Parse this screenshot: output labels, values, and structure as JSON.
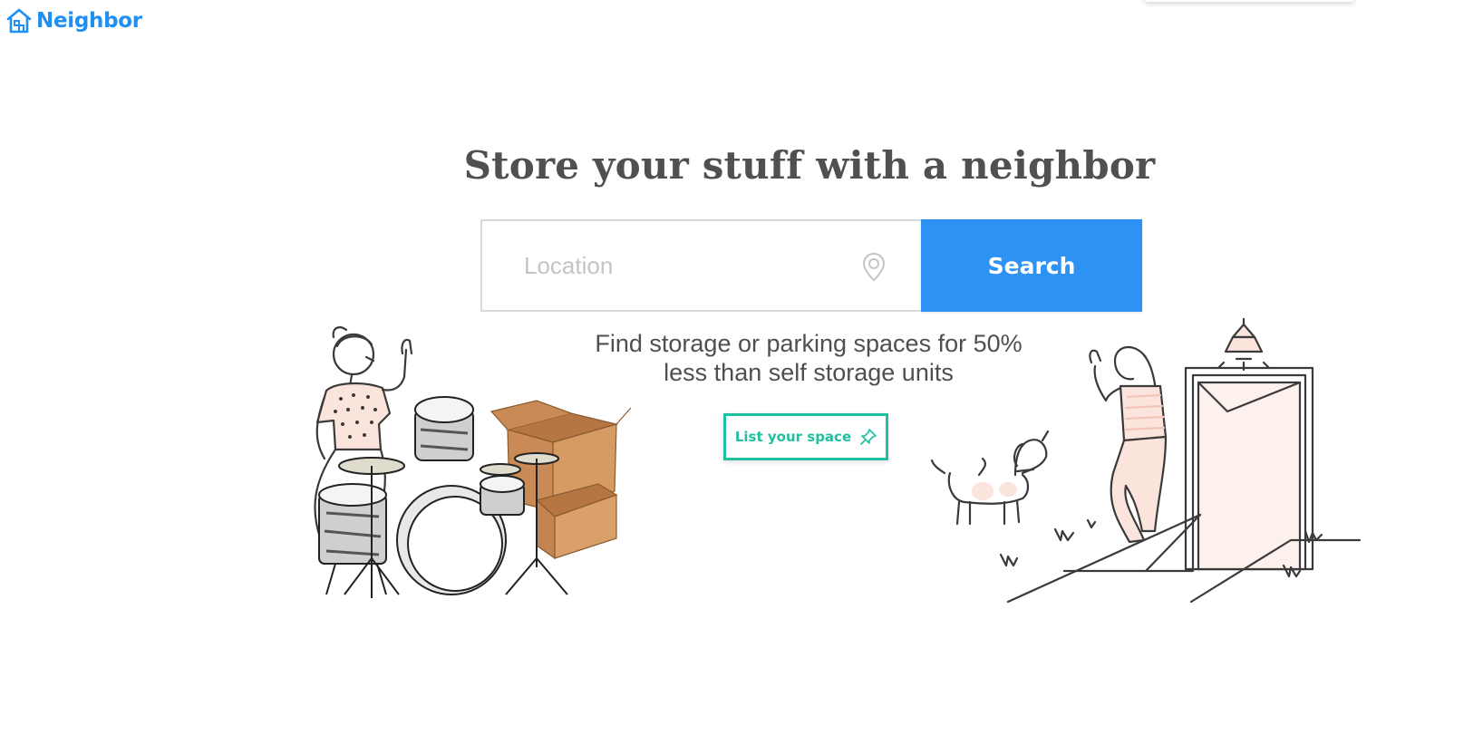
{
  "header": {
    "brand": "Neighbor"
  },
  "hero": {
    "headline": "Store your stuff with a neighbor",
    "location_placeholder": "Location",
    "search_label": "Search",
    "subtitle_line1": "Find storage or parking spaces for 50%",
    "subtitle_line2": "less than self storage units",
    "list_space_label": "List your space"
  },
  "icons": {
    "logo": "house-icon",
    "location": "map-pin-icon",
    "list_space": "pushpin-icon"
  },
  "colors": {
    "brand_blue": "#1f8ff3",
    "search_blue": "#2e91f4",
    "teal": "#1fbf9f",
    "text_dark": "#4a4a4a",
    "border_gray": "#d9d9d9",
    "placeholder_gray": "#c4c4c4",
    "illustration_pink": "#fbe4dc",
    "box_brown": "#c98a55"
  }
}
